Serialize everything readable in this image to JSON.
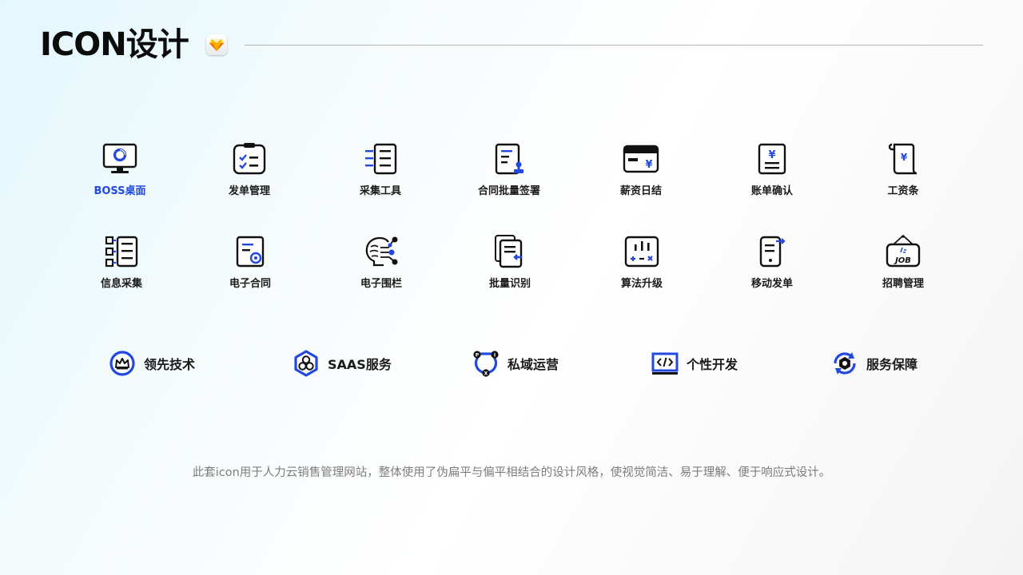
{
  "title": "ICON设计",
  "colors": {
    "accent": "#2248e0",
    "ink": "#111111"
  },
  "icons_row1": [
    {
      "icon": "monitor-chart-icon",
      "label": "BOSS桌面",
      "active": true
    },
    {
      "icon": "clipboard-checklist-icon",
      "label": "发单管理"
    },
    {
      "icon": "list-document-icon",
      "label": "采集工具"
    },
    {
      "icon": "document-stamp-icon",
      "label": "合同批量签署"
    },
    {
      "icon": "card-yuan-icon",
      "label": "薪资日结"
    },
    {
      "icon": "bill-yuan-icon",
      "label": "账单确认"
    },
    {
      "icon": "scroll-yuan-icon",
      "label": "工资条"
    }
  ],
  "icons_row2": [
    {
      "icon": "flow-list-icon",
      "label": "信息采集"
    },
    {
      "icon": "contract-badge-icon",
      "label": "电子合同"
    },
    {
      "icon": "head-network-icon",
      "label": "电子围栏"
    },
    {
      "icon": "stacked-docs-icon",
      "label": "批量识别"
    },
    {
      "icon": "calculator-chart-icon",
      "label": "算法升级"
    },
    {
      "icon": "mobile-send-icon",
      "label": "移动发单"
    },
    {
      "icon": "job-sign-icon",
      "label": "招聘管理"
    }
  ],
  "features": [
    {
      "icon": "crown-circle-icon",
      "label": "领先技术"
    },
    {
      "icon": "hexagon-cluster-icon",
      "label": "SAAS服务"
    },
    {
      "icon": "cycle-nodes-icon",
      "label": "私域运营"
    },
    {
      "icon": "code-window-icon",
      "label": "个性开发"
    },
    {
      "icon": "gear-refresh-icon",
      "label": "服务保障"
    }
  ],
  "footnote": "此套icon用于人力云销售管理网站，整体使用了伪扁平与偏平相结合的设计风格，使视觉简洁、易于理解、便于响应式设计。"
}
